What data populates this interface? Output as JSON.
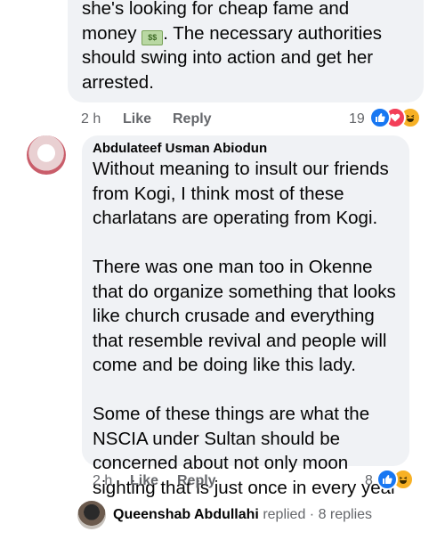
{
  "comment1": {
    "text_line1": "she's looking for cheap fame and",
    "text_before_emoji": "money ",
    "emoji": "money-with-wings-emoji",
    "emoji_label": "$$",
    "text_after_emoji": ". The necessary authorities should swing into action and get her arrested.",
    "time": "2 h",
    "like": "Like",
    "reply": "Reply",
    "reaction_count": "19",
    "reactions": [
      "like",
      "love",
      "haha"
    ]
  },
  "comment2": {
    "author": "Abdulateef Usman Abiodun",
    "paragraphs": [
      "Without meaning to insult our friends from Kogi, I think most of these charlatans are operating from Kogi.",
      "There was one man too in Okenne that do organize something that looks like church crusade and everything that resemble revival and people will come and be doing like this lady.",
      "Some of these things are what the NSCIA under Sultan should be concerned about not only moon sighting that is just once in every year"
    ],
    "time": "2 h",
    "like": "Like",
    "reply": "Reply",
    "reaction_count": "8",
    "reactions": [
      "like",
      "haha"
    ]
  },
  "replies": {
    "name": "Queenshab Abdullahi",
    "action": " replied",
    "separator": " · ",
    "count": "8 replies"
  },
  "colors": {
    "bubble": "#f0f2f5",
    "meta_text": "#65676b",
    "like_blue": "#1877f2",
    "love_red": "#f33e58",
    "haha_yellow": "#f7b125"
  }
}
